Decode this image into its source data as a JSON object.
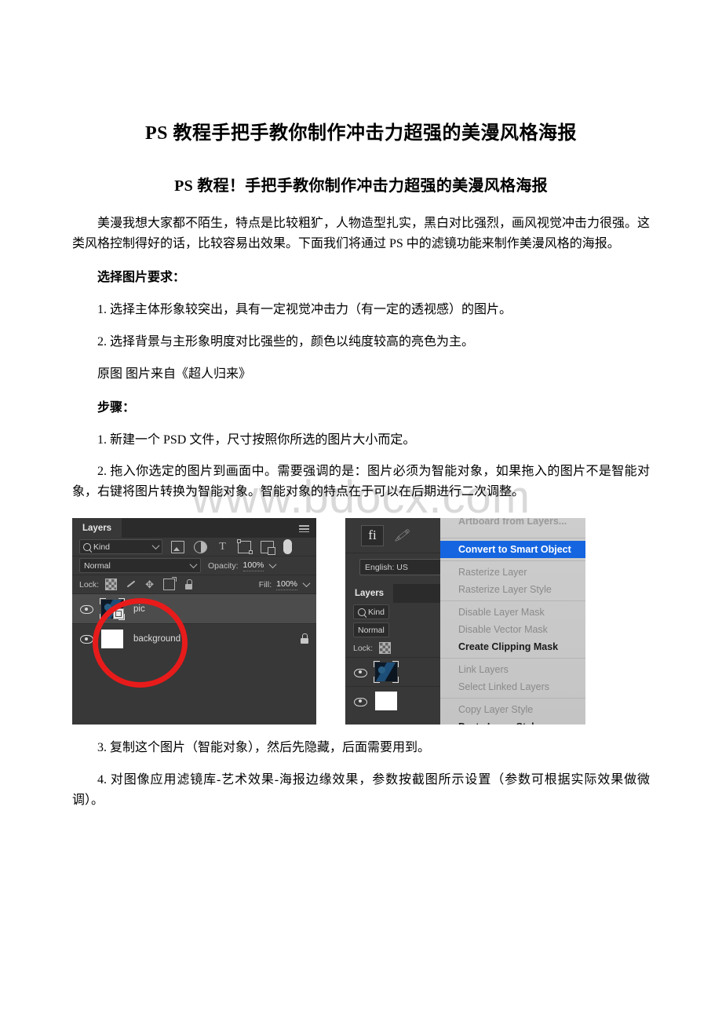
{
  "document": {
    "title": "PS 教程手把手教你制作冲击力超强的美漫风格海报",
    "subtitle": "PS 教程！手把手教你制作冲击力超强的美漫风格海报",
    "watermark": "www.bdocx.com",
    "paragraphs": {
      "intro": "美漫我想大家都不陌生，特点是比较粗犷，人物造型扎实，黑白对比强烈，画风视觉冲击力很强。这类风格控制得好的话，比较容易出效果。下面我们将通过 PS 中的滤镜功能来制作美漫风格的海报。",
      "requirements_heading": "选择图片要求：",
      "req_1": "1. 选择主体形象较突出，具有一定视觉冲击力（有一定的透视感）的图片。",
      "req_2": "2. 选择背景与主形象明度对比强些的，颜色以纯度较高的亮色为主。",
      "source_note": "原图 图片来自《超人归来》",
      "steps_heading": "步骤：",
      "step_1": "1. 新建一个 PSD 文件，尺寸按照你所选的图片大小而定。",
      "step_2": "2. 拖入你选定的图片到画面中。需要强调的是：图片必须为智能对象，如果拖入的图片不是智能对象，右键将图片转换为智能对象。智能对象的特点在于可以在后期进行二次调整。",
      "step_3": "3. 复制这个图片（智能对象），然后先隐藏，后面需要用到。",
      "step_4": "4. 对图像应用滤镜库-艺术效果-海报边缘效果，参数按截图所示设置（参数可根据实际效果做微调）。"
    }
  },
  "figure_left": {
    "panel_tab": "Layers",
    "filter_kind": "Kind",
    "blend_mode": "Normal",
    "opacity_label": "Opacity:",
    "opacity_value": "100%",
    "lock_label": "Lock:",
    "fill_label": "Fill:",
    "fill_value": "100%",
    "layers": [
      {
        "name": "pic",
        "selected": true,
        "locked": false
      },
      {
        "name": "background",
        "selected": false,
        "locked": true
      }
    ],
    "annotation_color": "#e81b1b"
  },
  "figure_right": {
    "fi_label": "fi",
    "language": "English: US",
    "panel_tab": "Layers",
    "filter_kind": "Kind",
    "blend_mode": "Normal",
    "lock_label": "Lock:",
    "highlight_color": "#1565e0",
    "menu_items": [
      {
        "label": "Artboard from Layers...",
        "state": "clipped"
      },
      {
        "label": "Convert to Smart Object",
        "state": "highlight"
      },
      {
        "label": "Rasterize Layer",
        "state": "disabled"
      },
      {
        "label": "Rasterize Layer Style",
        "state": "disabled"
      },
      {
        "label": "Disable Layer Mask",
        "state": "disabled"
      },
      {
        "label": "Disable Vector Mask",
        "state": "disabled"
      },
      {
        "label": "Create Clipping Mask",
        "state": "enabled"
      },
      {
        "label": "Link Layers",
        "state": "disabled"
      },
      {
        "label": "Select Linked Layers",
        "state": "disabled"
      },
      {
        "label": "Copy Layer Style",
        "state": "disabled"
      },
      {
        "label": "Paste Layer Style",
        "state": "enabled"
      }
    ]
  }
}
